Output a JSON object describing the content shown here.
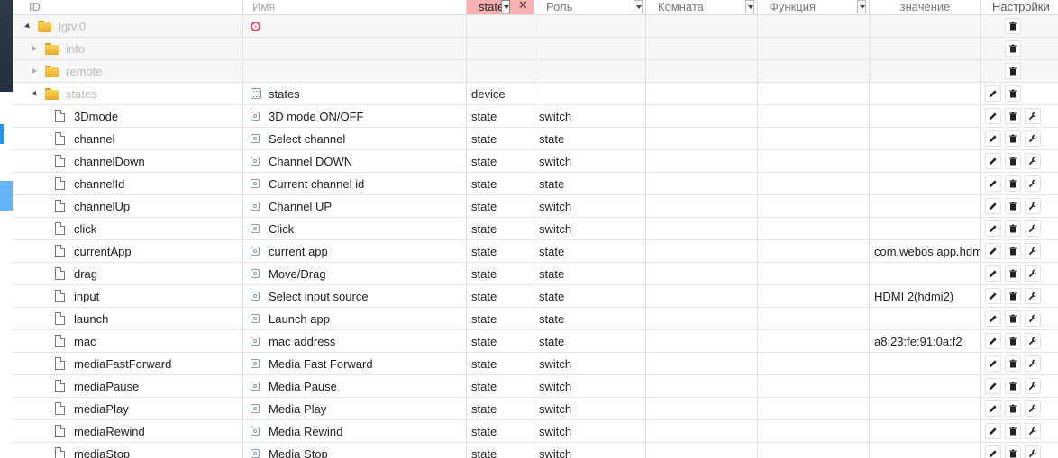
{
  "header": {
    "id": "ID",
    "name": "Имя",
    "type": "state",
    "role": "Роль",
    "room": "Комната",
    "function": "Функция",
    "value": "значение",
    "settings": "Настройки"
  },
  "tree": [
    {
      "level": 0,
      "kind": "folder",
      "expanded": true,
      "id": "lgtv.0",
      "name": "",
      "type": "",
      "role": "",
      "value": "",
      "buttons": [
        "delete"
      ],
      "muted": true,
      "ring": true
    },
    {
      "level": 1,
      "kind": "folder",
      "expanded": false,
      "id": "info",
      "name": "",
      "type": "",
      "role": "",
      "value": "",
      "buttons": [
        "delete"
      ],
      "muted": true
    },
    {
      "level": 1,
      "kind": "folder",
      "expanded": false,
      "id": "remote",
      "name": "",
      "type": "",
      "role": "",
      "value": "",
      "buttons": [
        "delete"
      ],
      "muted": true
    },
    {
      "level": 1,
      "kind": "folder",
      "expanded": true,
      "id": "states",
      "name": "states",
      "type": "device",
      "role": "",
      "value": "",
      "buttons": [
        "edit",
        "delete"
      ],
      "muted": true,
      "device": true
    },
    {
      "level": 2,
      "kind": "state",
      "id": "3Dmode",
      "name": "3D mode ON/OFF",
      "type": "state",
      "role": "switch",
      "value": "",
      "buttons": [
        "edit",
        "delete",
        "settings"
      ]
    },
    {
      "level": 2,
      "kind": "state",
      "id": "channel",
      "name": "Select channel",
      "type": "state",
      "role": "state",
      "value": "",
      "buttons": [
        "edit",
        "delete",
        "settings"
      ]
    },
    {
      "level": 2,
      "kind": "state",
      "id": "channelDown",
      "name": "Channel DOWN",
      "type": "state",
      "role": "switch",
      "value": "",
      "buttons": [
        "edit",
        "delete",
        "settings"
      ]
    },
    {
      "level": 2,
      "kind": "state",
      "id": "channelId",
      "name": "Current channel id",
      "type": "state",
      "role": "state",
      "value": "",
      "buttons": [
        "edit",
        "delete",
        "settings"
      ]
    },
    {
      "level": 2,
      "kind": "state",
      "id": "channelUp",
      "name": "Channel UP",
      "type": "state",
      "role": "switch",
      "value": "",
      "buttons": [
        "edit",
        "delete",
        "settings"
      ]
    },
    {
      "level": 2,
      "kind": "state",
      "id": "click",
      "name": "Click",
      "type": "state",
      "role": "switch",
      "value": "",
      "buttons": [
        "edit",
        "delete",
        "settings"
      ]
    },
    {
      "level": 2,
      "kind": "state",
      "id": "currentApp",
      "name": "current app",
      "type": "state",
      "role": "state",
      "value": "com.webos.app.hdmi",
      "buttons": [
        "edit",
        "delete",
        "settings"
      ]
    },
    {
      "level": 2,
      "kind": "state",
      "id": "drag",
      "name": "Move/Drag",
      "type": "state",
      "role": "state",
      "value": "",
      "buttons": [
        "edit",
        "delete",
        "settings"
      ]
    },
    {
      "level": 2,
      "kind": "state",
      "id": "input",
      "name": "Select input source",
      "type": "state",
      "role": "state",
      "value": "HDMI 2(hdmi2)",
      "buttons": [
        "edit",
        "delete",
        "settings"
      ]
    },
    {
      "level": 2,
      "kind": "state",
      "id": "launch",
      "name": "Launch app",
      "type": "state",
      "role": "state",
      "value": "",
      "buttons": [
        "edit",
        "delete",
        "settings"
      ]
    },
    {
      "level": 2,
      "kind": "state",
      "id": "mac",
      "name": "mac address",
      "type": "state",
      "role": "state",
      "value": "a8:23:fe:91:0a:f2",
      "buttons": [
        "edit",
        "delete",
        "settings"
      ]
    },
    {
      "level": 2,
      "kind": "state",
      "id": "mediaFastForward",
      "name": "Media Fast Forward",
      "type": "state",
      "role": "switch",
      "value": "",
      "buttons": [
        "edit",
        "delete",
        "settings"
      ]
    },
    {
      "level": 2,
      "kind": "state",
      "id": "mediaPause",
      "name": "Media Pause",
      "type": "state",
      "role": "switch",
      "value": "",
      "buttons": [
        "edit",
        "delete",
        "settings"
      ]
    },
    {
      "level": 2,
      "kind": "state",
      "id": "mediaPlay",
      "name": "Media Play",
      "type": "state",
      "role": "switch",
      "value": "",
      "buttons": [
        "edit",
        "delete",
        "settings"
      ]
    },
    {
      "level": 2,
      "kind": "state",
      "id": "mediaRewind",
      "name": "Media Rewind",
      "type": "state",
      "role": "switch",
      "value": "",
      "buttons": [
        "edit",
        "delete",
        "settings"
      ]
    },
    {
      "level": 2,
      "kind": "state",
      "id": "mediaStop",
      "name": "Media Stop",
      "type": "state",
      "role": "switch",
      "value": "",
      "buttons": [
        "edit",
        "delete",
        "settings"
      ]
    }
  ]
}
